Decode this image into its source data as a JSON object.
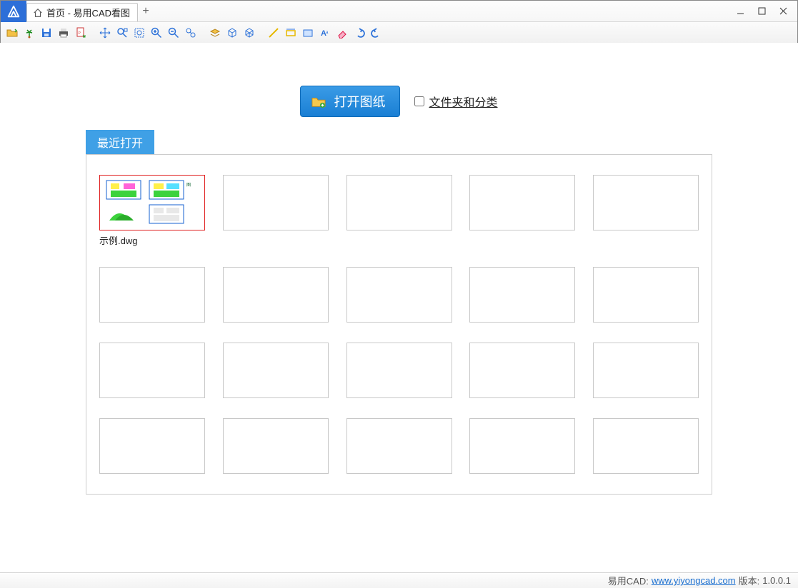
{
  "tab": {
    "title": "首页 - 易用CAD看图"
  },
  "toolbar_icons": [
    "open-folder-icon",
    "palm-icon",
    "save-icon",
    "print-icon",
    "export-pdf-icon",
    "pan-icon",
    "zoom-extents-icon",
    "zoom-window-icon",
    "zoom-in-icon",
    "zoom-out-icon",
    "zoom-realtime-icon",
    "layer-icon",
    "3d-box-icon",
    "3d-wire-icon",
    "measure-line-icon",
    "measure-rect-icon",
    "measure-area-icon",
    "text-annot-icon",
    "eraser-icon",
    "undo-icon",
    "redo-icon"
  ],
  "open_button": "打开图纸",
  "folder_checkbox_label": "文件夹和分类",
  "recent_label": "最近打开",
  "recent_files": [
    {
      "name": "示例.dwg"
    }
  ],
  "footer": {
    "brand": "易用CAD:",
    "url": "www.yiyongcad.com",
    "version_label": "版本:",
    "version": "1.0.0.1"
  }
}
